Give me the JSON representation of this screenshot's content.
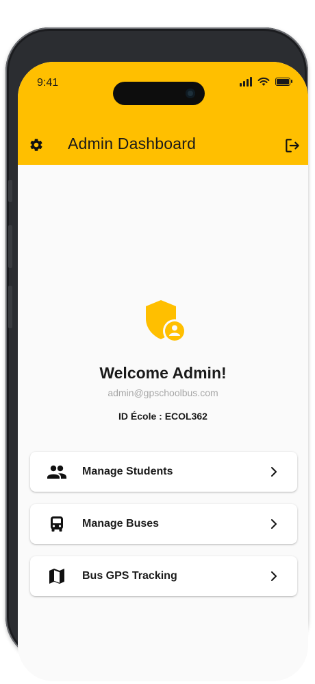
{
  "status_bar": {
    "time": "9:41"
  },
  "header": {
    "title": "Admin Dashboard",
    "settings_icon": "gear-icon",
    "logout_icon": "logout-icon",
    "background_color": "#FFBF00"
  },
  "profile": {
    "icon": "admin-shield-icon",
    "welcome": "Welcome Admin!",
    "email": "admin@gpschoolbus.com",
    "school_id": "ID École : ECOL362"
  },
  "menu": [
    {
      "label": "Manage Students",
      "icon": "people-icon"
    },
    {
      "label": "Manage Buses",
      "icon": "bus-icon"
    },
    {
      "label": "Bus GPS Tracking",
      "icon": "map-icon"
    }
  ]
}
